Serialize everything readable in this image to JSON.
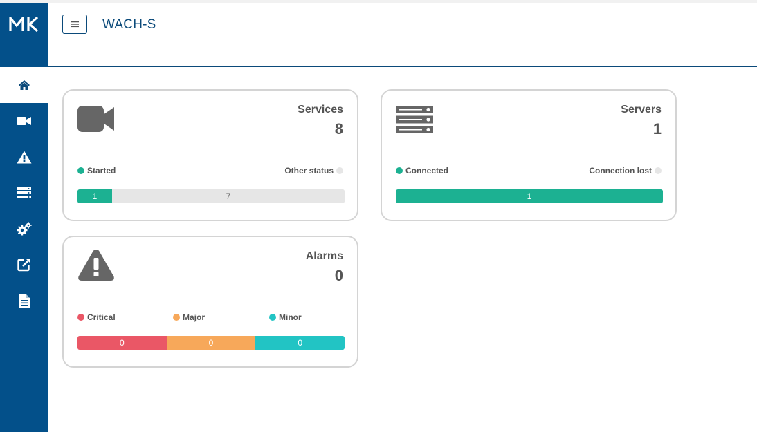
{
  "brand": {
    "logo_text": "MK"
  },
  "header": {
    "title": "WACH-S"
  },
  "colors": {
    "sidebar": "#03508a",
    "green": "#1cb192",
    "gray": "#e6e6e6",
    "critical": "#ea5766",
    "major": "#f7a85a",
    "minor": "#22c4c4"
  },
  "sidebar": {
    "items": [
      {
        "icon": "home-icon",
        "active": true
      },
      {
        "icon": "video-camera-icon",
        "active": false
      },
      {
        "icon": "warning-icon",
        "active": false
      },
      {
        "icon": "server-icon",
        "active": false
      },
      {
        "icon": "gears-icon",
        "active": false
      },
      {
        "icon": "external-link-icon",
        "active": false
      },
      {
        "icon": "document-icon",
        "active": false
      }
    ]
  },
  "cards": {
    "services": {
      "label": "Services",
      "count": "8",
      "icon": "video-camera-icon",
      "legend_started": "Started",
      "legend_other": "Other status",
      "started_value": 1,
      "other_value": 7,
      "started_text": "1",
      "other_text": "7"
    },
    "servers": {
      "label": "Servers",
      "count": "1",
      "icon": "server-icon",
      "legend_connected": "Connected",
      "legend_lost": "Connection lost",
      "connected_value": 1,
      "lost_value": 0,
      "connected_text": "1"
    },
    "alarms": {
      "label": "Alarms",
      "count": "0",
      "icon": "warning-icon",
      "legend_critical": "Critical",
      "legend_major": "Major",
      "legend_minor": "Minor",
      "critical_text": "0",
      "major_text": "0",
      "minor_text": "0"
    }
  }
}
